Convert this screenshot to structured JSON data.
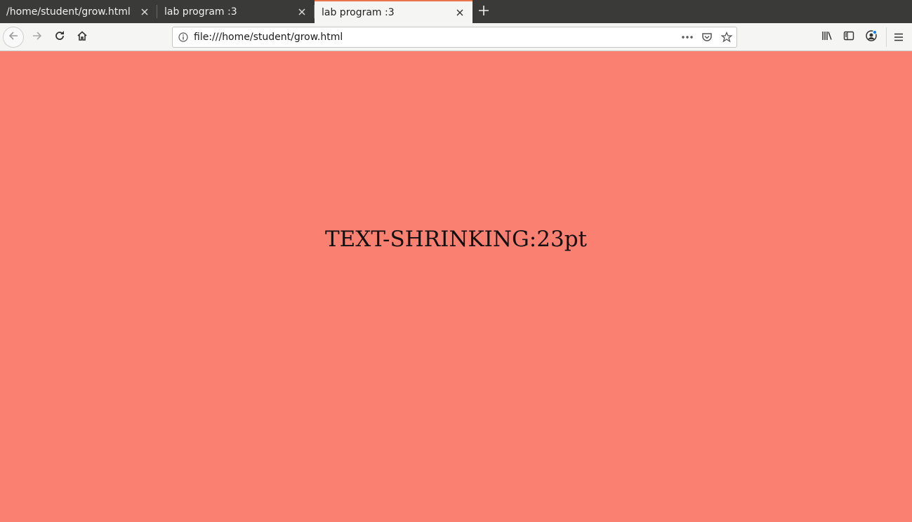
{
  "tabs": [
    {
      "label": "/home/student/grow.html",
      "active": false
    },
    {
      "label": "lab program :3",
      "active": false
    },
    {
      "label": "lab program :3",
      "active": true
    }
  ],
  "toolbar": {
    "url": "file:///home/student/grow.html"
  },
  "icons": {
    "back": "back-arrow-icon",
    "forward": "forward-arrow-icon",
    "reload": "reload-icon",
    "home": "home-icon",
    "info": "info-icon",
    "page_actions": "more-dots-icon",
    "pocket": "pocket-icon",
    "bookmark": "star-icon",
    "library": "library-icon",
    "sidebar": "sidebar-icon",
    "account": "account-icon",
    "menu": "hamburger-menu-icon",
    "new_tab": "plus-icon",
    "close": "close-icon"
  },
  "page": {
    "message": "TEXT-SHRINKING:23pt",
    "background_color": "#fa8072"
  },
  "colors": {
    "tab_accent": "#e8764c",
    "tabbar_bg": "#3a3a38"
  }
}
